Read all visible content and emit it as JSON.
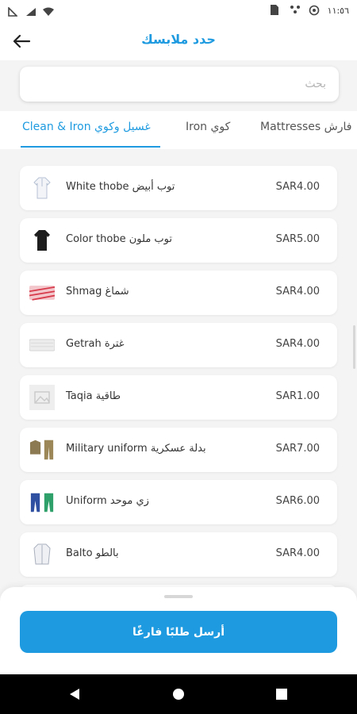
{
  "status_bar": {
    "time": "١١:٥٦"
  },
  "header": {
    "title": "حدد ملابسك"
  },
  "search": {
    "placeholder": "بحث"
  },
  "tabs": [
    {
      "label": "Clean & Iron  غسيل وكوي",
      "active": true
    },
    {
      "label": "Iron  كوي",
      "active": false
    },
    {
      "label": "Mattresses  فارش",
      "active": false
    }
  ],
  "items": [
    {
      "name": "White thobe  توب أبيض",
      "price": "SAR4.00",
      "icon": "white-thobe-icon"
    },
    {
      "name": "Color thobe  توب ملون",
      "price": "SAR5.00",
      "icon": "color-thobe-icon"
    },
    {
      "name": "Shmag  شماغ",
      "price": "SAR4.00",
      "icon": "shmag-icon"
    },
    {
      "name": "Getrah  غترة",
      "price": "SAR4.00",
      "icon": "getrah-icon"
    },
    {
      "name": "Taqia  طاقية",
      "price": "SAR1.00",
      "icon": "taqia-placeholder-icon"
    },
    {
      "name": "Military uniform  بدلة عسكرية",
      "price": "SAR7.00",
      "icon": "military-uniform-icon"
    },
    {
      "name": "Uniform  زي موحد",
      "price": "SAR6.00",
      "icon": "uniform-icon"
    },
    {
      "name": "Balto  بالطو",
      "price": "SAR4.00",
      "icon": "balto-icon"
    }
  ],
  "cta": {
    "label": "أرسل طلبًا فارغًا"
  },
  "colors": {
    "accent": "#1e9be0",
    "background": "#f4f4f4"
  }
}
